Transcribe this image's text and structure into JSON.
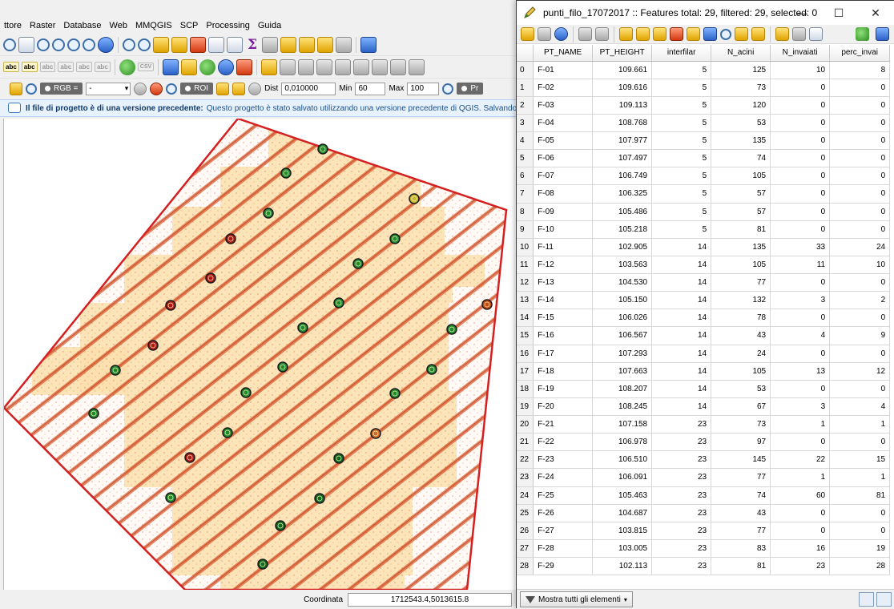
{
  "qgis": {
    "menu": [
      "ttore",
      "Raster",
      "Database",
      "Web",
      "MMQGIS",
      "SCP",
      "Processing",
      "Guida"
    ],
    "scp_toolbar": {
      "rgb_label": "RGB =",
      "rgb_value": "-",
      "roi_label": "ROI",
      "dist_label": "Dist",
      "dist_value": "0,010000",
      "min_label": "Min",
      "min_value": "60",
      "max_label": "Max",
      "max_value": "100",
      "pre_label": "Pr"
    },
    "message": {
      "title": "Il file di progetto è di una versione precedente:",
      "text": "Questo progetto è stato salvato utilizzando una versione precedente di QGIS. Salvando qu"
    },
    "status": {
      "coord_label": "Coordinata",
      "coord_value": "1712543.4,5013615.8"
    },
    "colors": {
      "boundary": "#d42020",
      "tiles": "#fbe0b4",
      "stripes": "#d8542a"
    }
  },
  "attribute_table": {
    "title": "punti_filo_17072017 :: Features total: 29, filtered: 29, selected: 0",
    "window_buttons": {
      "minimize": "—",
      "maximize": "☐",
      "close": "✕"
    },
    "columns": [
      "PT_NAME",
      "PT_HEIGHT",
      "interfilar",
      "N_acini",
      "N_invaiati",
      "perc_invai"
    ],
    "rows": [
      [
        "0",
        "F-01",
        "109.661",
        "5",
        "125",
        "10",
        "8"
      ],
      [
        "1",
        "F-02",
        "109.616",
        "5",
        "73",
        "0",
        "0"
      ],
      [
        "2",
        "F-03",
        "109.113",
        "5",
        "120",
        "0",
        "0"
      ],
      [
        "3",
        "F-04",
        "108.768",
        "5",
        "53",
        "0",
        "0"
      ],
      [
        "4",
        "F-05",
        "107.977",
        "5",
        "135",
        "0",
        "0"
      ],
      [
        "5",
        "F-06",
        "107.497",
        "5",
        "74",
        "0",
        "0"
      ],
      [
        "6",
        "F-07",
        "106.749",
        "5",
        "105",
        "0",
        "0"
      ],
      [
        "7",
        "F-08",
        "106.325",
        "5",
        "57",
        "0",
        "0"
      ],
      [
        "8",
        "F-09",
        "105.486",
        "5",
        "57",
        "0",
        "0"
      ],
      [
        "9",
        "F-10",
        "105.218",
        "5",
        "81",
        "0",
        "0"
      ],
      [
        "10",
        "F-11",
        "102.905",
        "14",
        "135",
        "33",
        "24"
      ],
      [
        "11",
        "F-12",
        "103.563",
        "14",
        "105",
        "11",
        "10"
      ],
      [
        "12",
        "F-13",
        "104.530",
        "14",
        "77",
        "0",
        "0"
      ],
      [
        "13",
        "F-14",
        "105.150",
        "14",
        "132",
        "3",
        "2"
      ],
      [
        "14",
        "F-15",
        "106.026",
        "14",
        "78",
        "0",
        "0"
      ],
      [
        "15",
        "F-16",
        "106.567",
        "14",
        "43",
        "4",
        "9"
      ],
      [
        "16",
        "F-17",
        "107.293",
        "14",
        "24",
        "0",
        "0"
      ],
      [
        "17",
        "F-18",
        "107.663",
        "14",
        "105",
        "13",
        "12"
      ],
      [
        "18",
        "F-19",
        "108.207",
        "14",
        "53",
        "0",
        "0"
      ],
      [
        "19",
        "F-20",
        "108.245",
        "14",
        "67",
        "3",
        "4"
      ],
      [
        "20",
        "F-21",
        "107.158",
        "23",
        "73",
        "1",
        "1"
      ],
      [
        "21",
        "F-22",
        "106.978",
        "23",
        "97",
        "0",
        "0"
      ],
      [
        "22",
        "F-23",
        "106.510",
        "23",
        "145",
        "22",
        "15"
      ],
      [
        "23",
        "F-24",
        "106.091",
        "23",
        "77",
        "1",
        "1"
      ],
      [
        "24",
        "F-25",
        "105.463",
        "23",
        "74",
        "60",
        "81"
      ],
      [
        "25",
        "F-26",
        "104.687",
        "23",
        "43",
        "0",
        "0"
      ],
      [
        "26",
        "F-27",
        "103.815",
        "23",
        "77",
        "0",
        "0"
      ],
      [
        "27",
        "F-28",
        "103.005",
        "23",
        "83",
        "16",
        "19"
      ],
      [
        "28",
        "F-29",
        "102.113",
        "23",
        "81",
        "23",
        "28"
      ]
    ],
    "show_all_label": "Mostra tutti gli elementi"
  }
}
